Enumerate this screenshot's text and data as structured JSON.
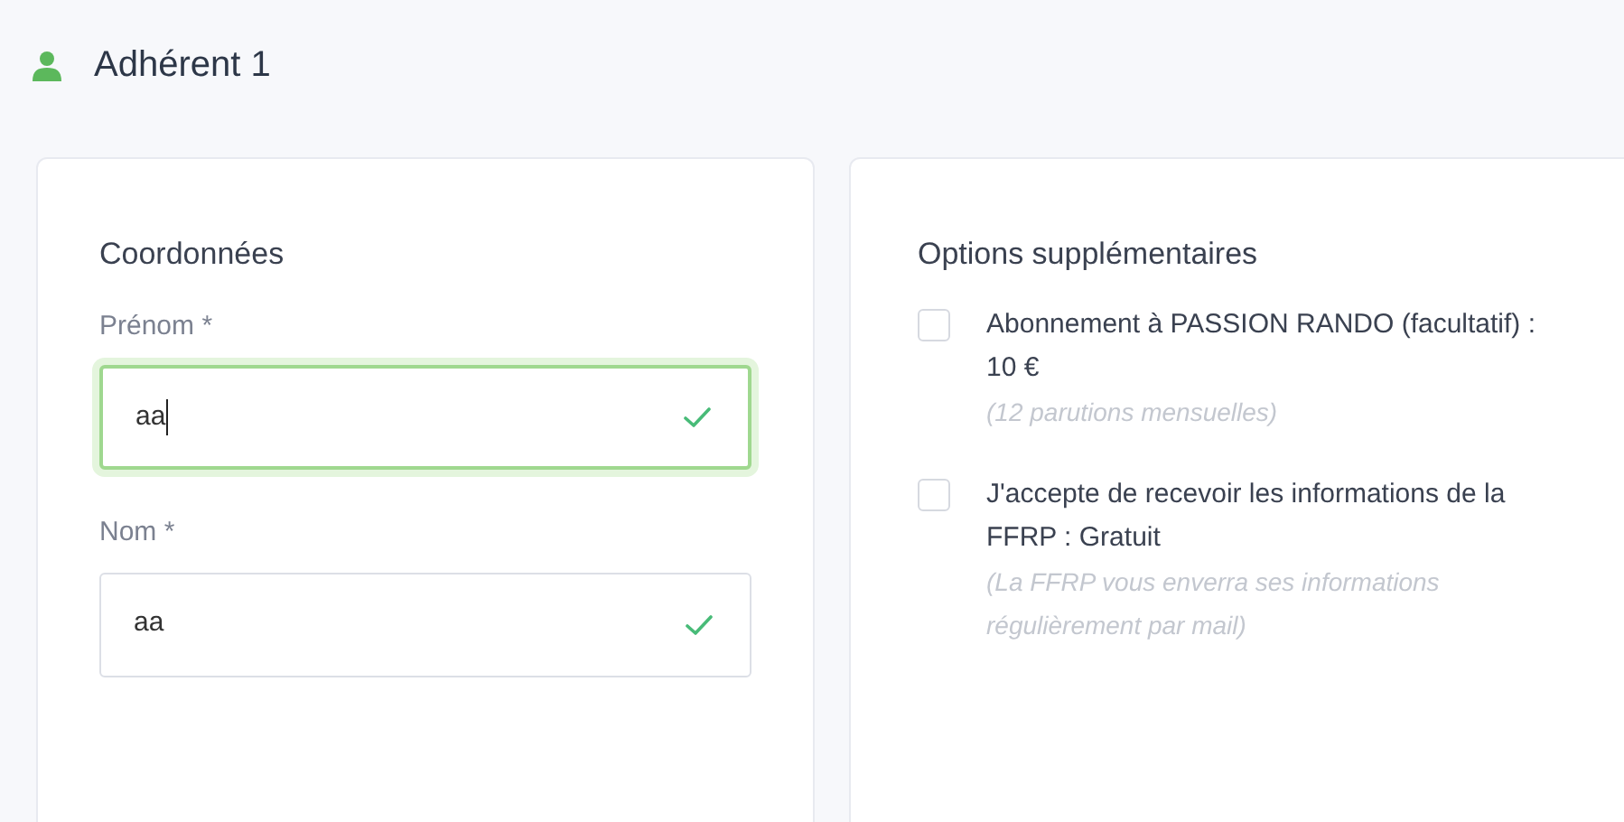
{
  "section": {
    "title": "Adhérent 1"
  },
  "contact": {
    "title": "Coordonnées",
    "fields": [
      {
        "label": "Prénom *",
        "value": "aa",
        "focused": true,
        "valid": true
      },
      {
        "label": "Nom *",
        "value": "aa",
        "focused": false,
        "valid": true
      }
    ]
  },
  "options": {
    "title": "Options supplémentaires",
    "items": [
      {
        "label": "Abonnement à PASSION RANDO (facultatif) : 10 €",
        "note": "(12 parutions mensuelles)",
        "checked": false
      },
      {
        "label": "J'accepte de recevoir les informations de la FFRP : Gratuit",
        "note": "(La FFRP vous enverra ses informations régulièrement par mail)",
        "checked": false
      }
    ]
  }
}
